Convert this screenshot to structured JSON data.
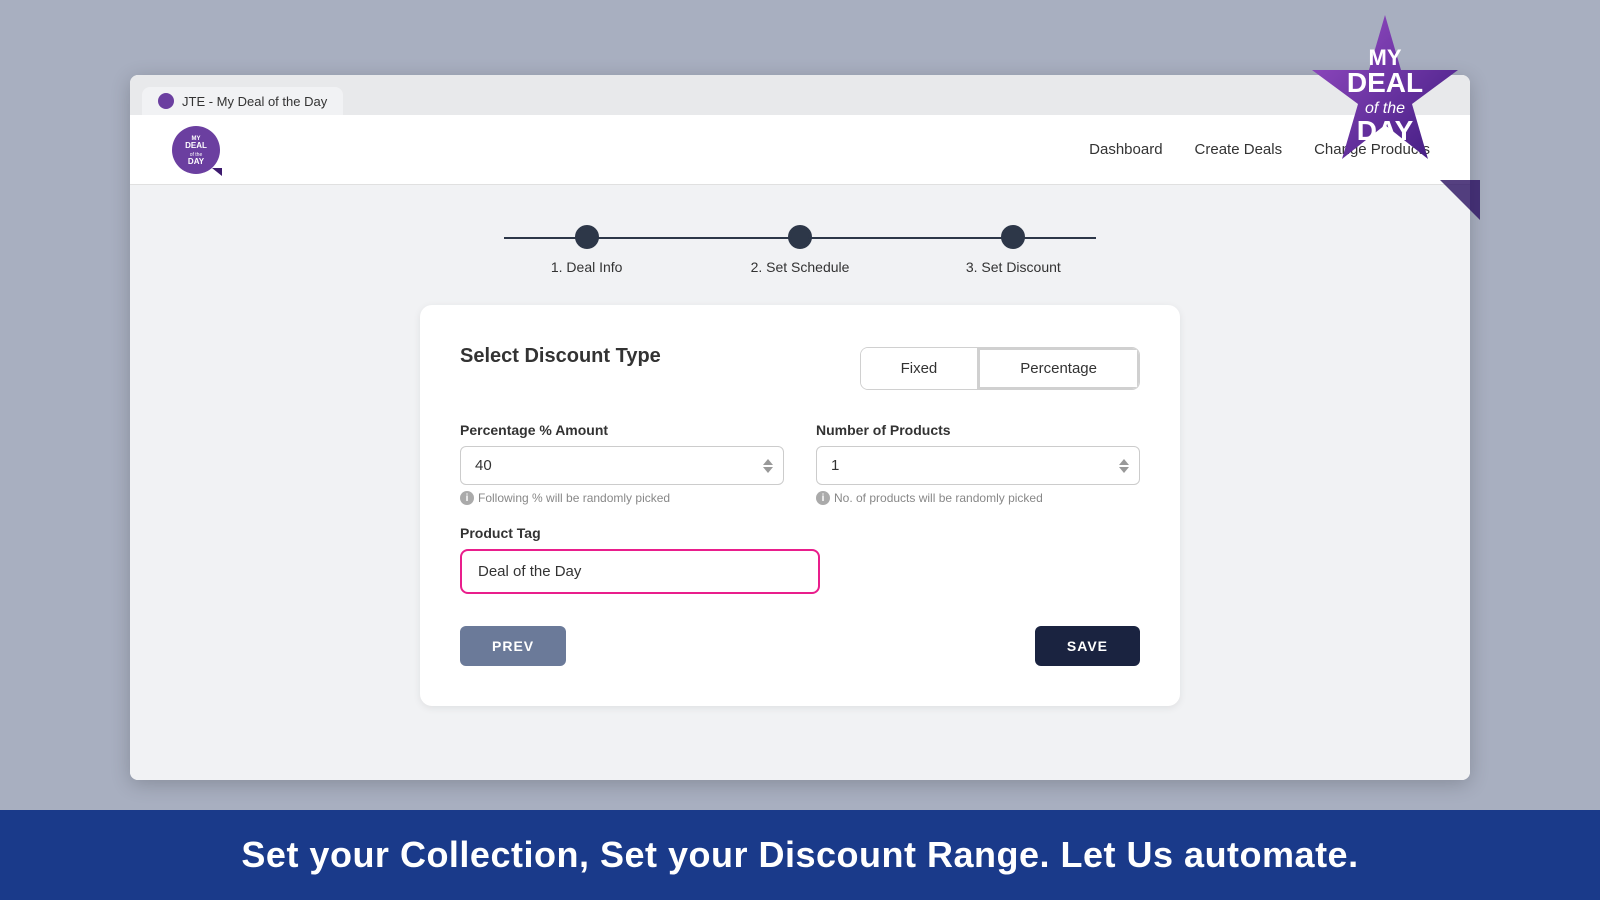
{
  "browser": {
    "tab_title": "JTE - My Deal of the Day",
    "favicon_color": "#6b3fa0"
  },
  "nav": {
    "logo_text": "MY DEAL of the DAY",
    "links": [
      {
        "id": "dashboard",
        "label": "Dashboard"
      },
      {
        "id": "create-deals",
        "label": "Create Deals"
      },
      {
        "id": "change-products",
        "label": "Change Products"
      }
    ]
  },
  "steps": [
    {
      "id": "deal-info",
      "label": "1. Deal Info",
      "active": true
    },
    {
      "id": "set-schedule",
      "label": "2. Set Schedule",
      "active": true
    },
    {
      "id": "set-discount",
      "label": "3. Set Discount",
      "active": true
    }
  ],
  "form": {
    "section_title": "Select Discount Type",
    "discount_types": [
      {
        "id": "fixed",
        "label": "Fixed",
        "active": false
      },
      {
        "id": "percentage",
        "label": "Percentage",
        "active": true
      }
    ],
    "percentage_label": "Percentage % Amount",
    "percentage_value": "40",
    "percentage_hint": "Following % will be randomly picked",
    "products_label": "Number of Products",
    "products_value": "1",
    "products_hint": "No. of products will be randomly picked",
    "product_tag_label": "Product Tag",
    "product_tag_value": "Deal of the Day",
    "product_tag_placeholder": "Deal of the Day"
  },
  "buttons": {
    "prev_label": "PREV",
    "save_label": "SAVE"
  },
  "banner": {
    "text": "Set your Collection, Set your Discount Range. Let Us automate."
  },
  "promo_badge": {
    "line1": "MY",
    "line2": "DEAL",
    "line3": "of the",
    "line4": "DAY"
  }
}
